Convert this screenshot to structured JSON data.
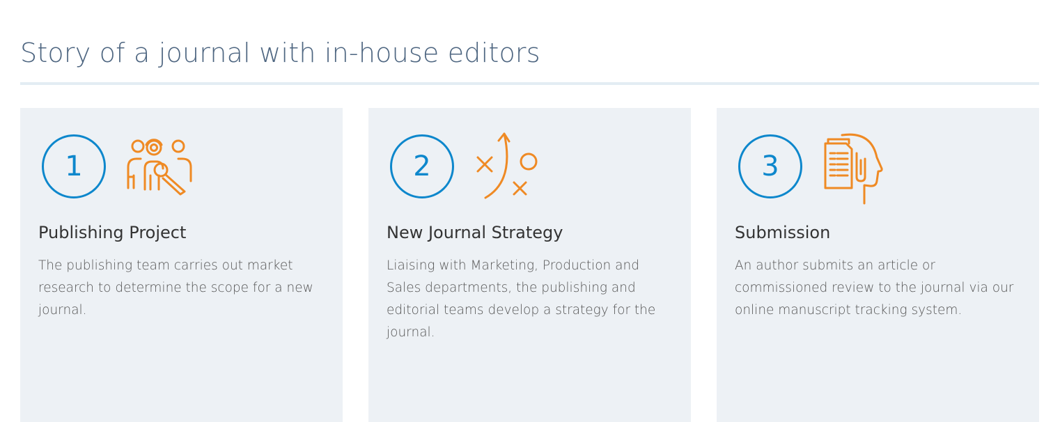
{
  "section": {
    "title": "Story of a journal with in-house editors"
  },
  "colors": {
    "accent_blue": "#0d87cc",
    "accent_orange": "#ef8a24",
    "card_background": "#edf1f5",
    "title": "#4d6580"
  },
  "steps": [
    {
      "number": "1",
      "icon": "team-search-icon",
      "title": "Publishing Project",
      "text": "The publishing team carries out market research to determine the scope for a new journal."
    },
    {
      "number": "2",
      "icon": "strategy-play-icon",
      "title": "New Journal Strategy",
      "text": "Liaising with Marketing, Production and Sales departments, the publishing and editorial teams develop a strategy for the journal."
    },
    {
      "number": "3",
      "icon": "manuscript-head-icon",
      "title": "Submission",
      "text": "An author submits an article or commissioned review to the journal via our online manuscript tracking system."
    }
  ]
}
